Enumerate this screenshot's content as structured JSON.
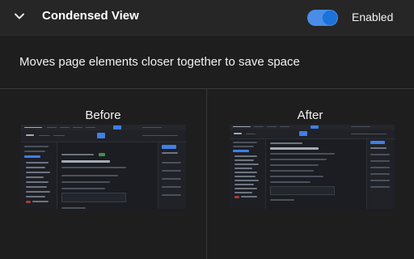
{
  "header": {
    "title": "Condensed View",
    "toggle_on": true,
    "status_label": "Enabled",
    "accent_color": "#4a8de8"
  },
  "description": "Moves page elements closer together to save space",
  "previews": {
    "before": {
      "label": "Before"
    },
    "after": {
      "label": "After"
    }
  }
}
